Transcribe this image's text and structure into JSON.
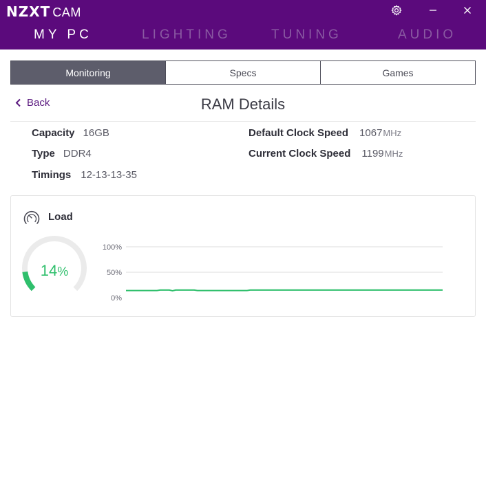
{
  "app": {
    "brand": "NZXT",
    "product": "CAM"
  },
  "nav": [
    {
      "label": "MY PC",
      "active": true
    },
    {
      "label": "LIGHTING",
      "active": false
    },
    {
      "label": "TUNING",
      "active": false
    },
    {
      "label": "AUDIO",
      "active": false
    }
  ],
  "window_controls": {
    "settings_icon": "gear-icon",
    "minimize_icon": "minimize-icon",
    "close_icon": "close-icon"
  },
  "tabs": [
    {
      "label": "Monitoring",
      "active": true
    },
    {
      "label": "Specs",
      "active": false
    },
    {
      "label": "Games",
      "active": false
    }
  ],
  "back": {
    "label": "Back"
  },
  "page_title": "RAM Details",
  "specs": {
    "capacity": {
      "label": "Capacity",
      "value": "16GB"
    },
    "type": {
      "label": "Type",
      "value": "DDR4"
    },
    "timings": {
      "label": "Timings",
      "value": "12-13-13-35"
    },
    "default_clock": {
      "label": "Default Clock Speed",
      "value": "1067",
      "unit": "MHz"
    },
    "current_clock": {
      "label": "Current Clock Speed",
      "value": "1199",
      "unit": "MHz"
    }
  },
  "load": {
    "title": "Load",
    "value_number": "14",
    "value_unit": "%",
    "fraction": 0.14
  },
  "colors": {
    "header_bg": "#5b0a7c",
    "nav_inactive": "#8a5aa2",
    "accent_green": "#2fbf6c",
    "tab_active_bg": "#5d5d6b"
  },
  "chart_data": {
    "type": "line",
    "title": "",
    "xlabel": "",
    "ylabel": "",
    "ylim": [
      0,
      100
    ],
    "yticks": [
      "100%",
      "50%",
      "0%"
    ],
    "grid": true,
    "series": [
      {
        "color": "#2fbf6c",
        "values": [
          14,
          14,
          14,
          14,
          14,
          14,
          14,
          14,
          14,
          14,
          14,
          15,
          15,
          15,
          15,
          13.5,
          15,
          15,
          15,
          15,
          15,
          15,
          15,
          14,
          14,
          14,
          14,
          14,
          14,
          14,
          14,
          14,
          14,
          14,
          14,
          14,
          14,
          14,
          14,
          14,
          15,
          15,
          15,
          15,
          15,
          15,
          15,
          15,
          15,
          15,
          15,
          15,
          15,
          15,
          15,
          15,
          15,
          15,
          15,
          15,
          15,
          15,
          15,
          15,
          15,
          15,
          15,
          15,
          15,
          15,
          15,
          15,
          15,
          15,
          15,
          15,
          15,
          15,
          15,
          15,
          15,
          15,
          15,
          15,
          15,
          15,
          15,
          15,
          15,
          15,
          15,
          15,
          15,
          15,
          15,
          15,
          15,
          15,
          15,
          15,
          15,
          15,
          15
        ]
      }
    ]
  }
}
